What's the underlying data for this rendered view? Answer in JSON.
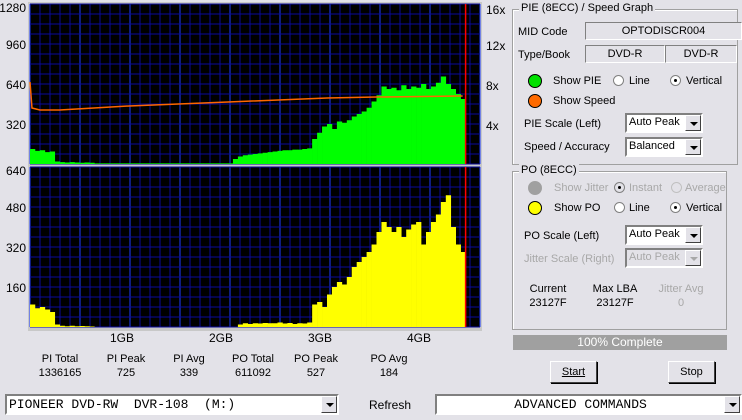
{
  "chart_data": [
    {
      "type": "bar",
      "name": "PIE / Speed graph",
      "x_unit": "GB",
      "x_start": 0,
      "x_step": 0.05,
      "ylim": [
        0,
        1280
      ],
      "y_ticks": [
        "1280",
        "960",
        "640",
        "320"
      ],
      "y2lim": [
        0,
        16
      ],
      "y2_ticks": [
        "16x",
        "12x",
        "8x",
        "4x"
      ],
      "x_ticks": [
        "1GB",
        "2GB",
        "3GB",
        "4GB"
      ],
      "grid": true,
      "bar_color": "#00ff00",
      "line_color": "#ff6600",
      "values": [
        120,
        105,
        110,
        95,
        100,
        20,
        15,
        12,
        15,
        12,
        10,
        12,
        10,
        5,
        5,
        5,
        5,
        5,
        5,
        5,
        5,
        5,
        5,
        5,
        5,
        5,
        5,
        5,
        5,
        5,
        5,
        5,
        5,
        5,
        5,
        5,
        5,
        5,
        5,
        5,
        5,
        40,
        60,
        70,
        75,
        80,
        85,
        90,
        95,
        100,
        105,
        110,
        110,
        115,
        115,
        120,
        125,
        200,
        250,
        300,
        320,
        280,
        340,
        330,
        350,
        380,
        400,
        420,
        450,
        500,
        550,
        620,
        600,
        610,
        590,
        630,
        600,
        620,
        610,
        640,
        600,
        620,
        650,
        700,
        640,
        600,
        560,
        520
      ],
      "speed": [
        [
          0,
          8.2
        ],
        [
          0.02,
          5.6
        ],
        [
          0.1,
          5.4
        ],
        [
          0.3,
          5.4
        ],
        [
          1.0,
          5.8
        ],
        [
          2.0,
          6.2
        ],
        [
          3.0,
          6.6
        ],
        [
          3.5,
          6.7
        ],
        [
          4.37,
          6.8
        ]
      ],
      "end_marker_gb": 4.4
    },
    {
      "type": "bar",
      "name": "PO graph",
      "x_unit": "GB",
      "x_start": 0,
      "x_step": 0.05,
      "ylim": [
        0,
        640
      ],
      "y_ticks": [
        "640",
        "480",
        "320",
        "160"
      ],
      "x_ticks": [
        "1GB",
        "2GB",
        "3GB",
        "4GB"
      ],
      "grid": true,
      "bar_color": "#ffff00",
      "values": [
        90,
        75,
        80,
        70,
        60,
        10,
        5,
        3,
        5,
        3,
        4,
        3,
        2,
        0,
        0,
        0,
        0,
        0,
        0,
        0,
        0,
        0,
        0,
        0,
        0,
        0,
        0,
        0,
        0,
        0,
        0,
        0,
        0,
        0,
        0,
        0,
        0,
        0,
        0,
        0,
        0,
        0,
        10,
        15,
        12,
        15,
        14,
        16,
        15,
        15,
        18,
        14,
        16,
        12,
        15,
        14,
        18,
        90,
        100,
        80,
        130,
        160,
        180,
        170,
        200,
        240,
        260,
        280,
        300,
        330,
        380,
        420,
        400,
        380,
        400,
        360,
        390,
        410,
        420,
        330,
        380,
        420,
        450,
        500,
        527,
        400,
        330,
        300
      ],
      "end_marker_gb": 4.4
    }
  ],
  "stats": {
    "labels": [
      "PI Total",
      "PI Peak",
      "PI Avg",
      "PO Total",
      "PO Peak",
      "PO Avg"
    ],
    "values": [
      "1336165",
      "725",
      "339",
      "611092",
      "527",
      "184"
    ]
  },
  "pie_group": {
    "title": "PIE (8ECC) / Speed Graph",
    "mid_label": "MID Code",
    "mid_value": "OPTODISCR004",
    "type_label": "Type/Book",
    "type_value": "DVD-R",
    "book_value": "DVD-R",
    "show_pie": "Show PIE",
    "line": "Line",
    "vertical": "Vertical",
    "show_speed": "Show Speed",
    "pie_scale_label": "PIE Scale (Left)",
    "pie_scale": "Auto Peak",
    "speed_label": "Speed / Accuracy",
    "speed_value": "Balanced",
    "pie_color": "#00e000",
    "speed_color": "#ff6a00"
  },
  "po_group": {
    "title": "PO (8ECC)",
    "show_jitter": "Show Jitter",
    "instant": "Instant",
    "average": "Average",
    "show_po": "Show PO",
    "line": "Line",
    "vertical": "Vertical",
    "po_scale_label": "PO Scale (Left)",
    "po_scale": "Auto Peak",
    "jitter_scale_label": "Jitter Scale (Right)",
    "jitter_scale": "Auto Peak",
    "current_label": "Current",
    "current_value": "23127F",
    "maxlba_label": "Max LBA",
    "maxlba_value": "23127F",
    "jitter_avg_label": "Jitter Avg",
    "jitter_avg_value": "0",
    "po_color": "#ffff00"
  },
  "progress": {
    "text": "100% Complete",
    "percent": 100
  },
  "buttons": {
    "start": "Start",
    "stop": "Stop",
    "refresh": "Refresh"
  },
  "drive": "PIONEER DVD-RW  DVR-108  (M:)",
  "commands": "ADVANCED COMMANDS"
}
